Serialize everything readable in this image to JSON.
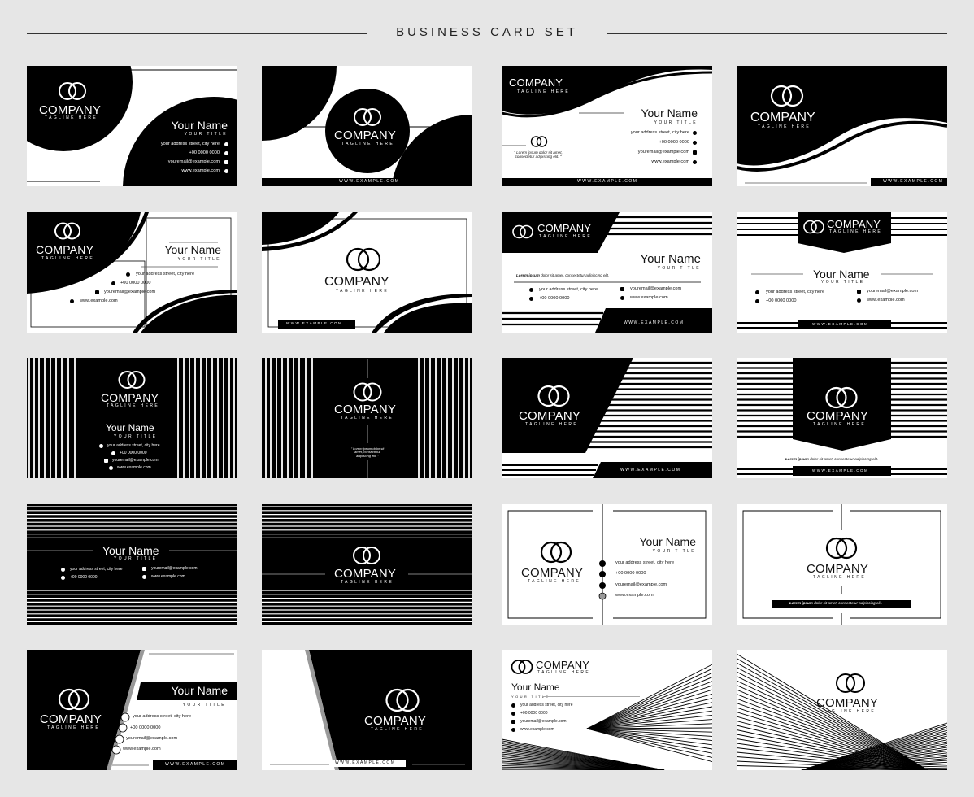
{
  "header": {
    "title": "BUSINESS CARD SET"
  },
  "brand": {
    "company": "COMPANY",
    "tagline": "TAGLINE HERE",
    "name": "Your Name",
    "title": "YOUR TITLE",
    "address": "your address street, city here",
    "phone": "+00 0000 0000",
    "email": "youremail@example.com",
    "website": "www.example.com",
    "website_caps": "WWW.EXAMPLE.COM",
    "lorem_bold": "Lorem ipsum",
    "lorem_rest": "dolor sit amet, consectetur adipiscing elit.",
    "lorem_short": "\" Lorem ipsum dolor sit amet, consectetur adipiscing elit. \""
  },
  "icons": {
    "logo": "interlocking-rings-icon",
    "address": "map-pin-icon",
    "phone": "phone-icon",
    "email": "envelope-icon",
    "website": "globe-icon"
  },
  "colors": {
    "background": "#e6e6e6",
    "dark": "#000000",
    "light": "#ffffff",
    "rule": "#333333"
  },
  "cards": [
    {
      "row": 1,
      "col": 1,
      "side": "front",
      "style": "circle-arcs"
    },
    {
      "row": 1,
      "col": 2,
      "side": "back",
      "style": "circle-arcs"
    },
    {
      "row": 1,
      "col": 3,
      "side": "front",
      "style": "wave"
    },
    {
      "row": 1,
      "col": 4,
      "side": "back",
      "style": "wave"
    },
    {
      "row": 2,
      "col": 1,
      "side": "front",
      "style": "swoosh-frame"
    },
    {
      "row": 2,
      "col": 2,
      "side": "back",
      "style": "swoosh-frame"
    },
    {
      "row": 2,
      "col": 3,
      "side": "front",
      "style": "stripes-trapezoid"
    },
    {
      "row": 2,
      "col": 4,
      "side": "back",
      "style": "stripes-banner"
    },
    {
      "row": 3,
      "col": 1,
      "side": "front",
      "style": "vertical-stripes"
    },
    {
      "row": 3,
      "col": 2,
      "side": "back",
      "style": "vertical-stripes"
    },
    {
      "row": 3,
      "col": 3,
      "side": "front",
      "style": "diagonal-stripes"
    },
    {
      "row": 3,
      "col": 4,
      "side": "back",
      "style": "stripes-pennant"
    },
    {
      "row": 4,
      "col": 1,
      "side": "front",
      "style": "horizontal-stripes"
    },
    {
      "row": 4,
      "col": 2,
      "side": "back",
      "style": "horizontal-stripes"
    },
    {
      "row": 4,
      "col": 3,
      "side": "front",
      "style": "minimal-frame"
    },
    {
      "row": 4,
      "col": 4,
      "side": "back",
      "style": "minimal-frame"
    },
    {
      "row": 5,
      "col": 1,
      "side": "front",
      "style": "slanted-split"
    },
    {
      "row": 5,
      "col": 2,
      "side": "back",
      "style": "slanted-split"
    },
    {
      "row": 5,
      "col": 3,
      "side": "front",
      "style": "line-fan"
    },
    {
      "row": 5,
      "col": 4,
      "side": "back",
      "style": "line-fan"
    }
  ]
}
